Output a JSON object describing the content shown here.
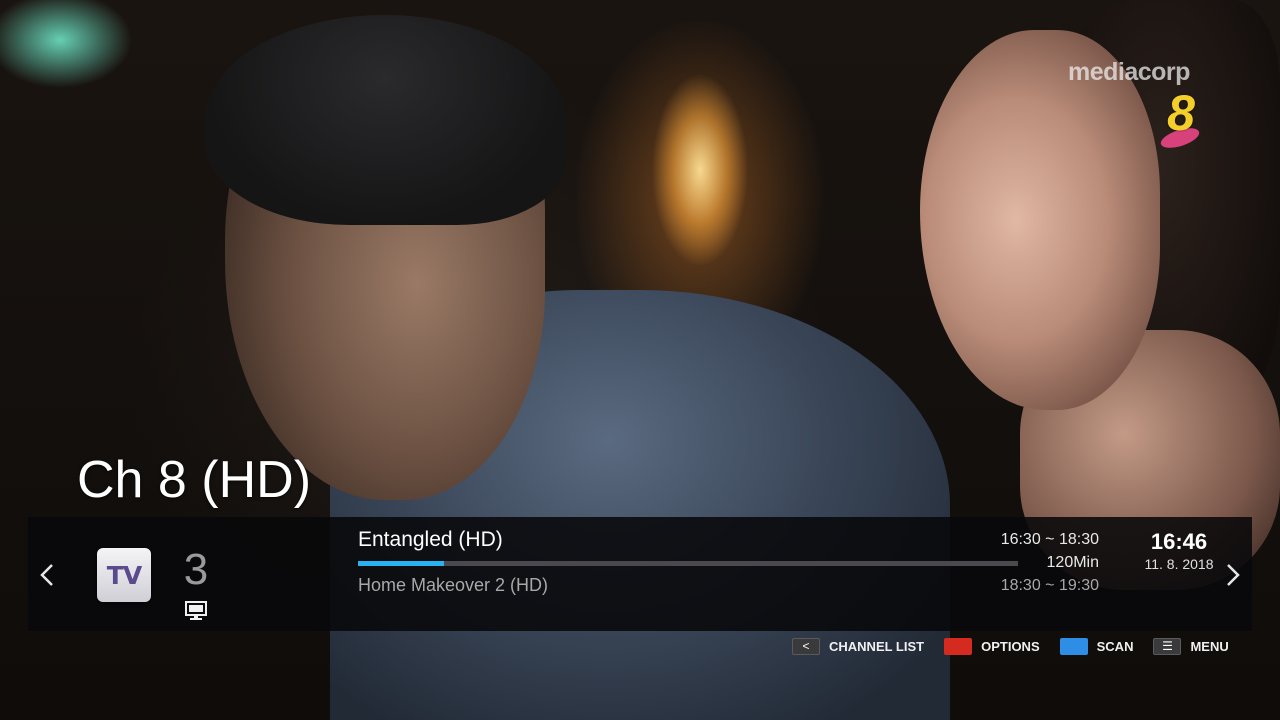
{
  "broadcaster": {
    "logo_text": "mediacorp",
    "logo_digit": "8",
    "colors": {
      "digit": "#f4cf2a",
      "swoosh": "#d7427a"
    }
  },
  "channel": {
    "title": "Ch 8 (HD)",
    "number": "3",
    "type_icon_label": "TV",
    "source_icon": "monitor-icon"
  },
  "program": {
    "current": {
      "title": "Entangled (HD)",
      "time": "16:30 ~ 18:30",
      "duration": "120Min",
      "progress": 0.13
    },
    "next": {
      "title": "Home Makeover 2 (HD)",
      "time": "18:30 ~ 19:30"
    }
  },
  "clock": {
    "time": "16:46",
    "date": "11. 8. 2018"
  },
  "navigation": {
    "prev_icon": "chevron-left-icon",
    "next_icon": "chevron-right-icon"
  },
  "hints": [
    {
      "key_icon": "back-key-icon",
      "key_glyph": "<",
      "label": "CHANNEL LIST"
    },
    {
      "key_icon": "red-key-icon",
      "key_color": "#d42a1f",
      "label": "OPTIONS"
    },
    {
      "key_icon": "blue-key-icon",
      "key_color": "#2e8ee6",
      "label": "SCAN"
    },
    {
      "key_icon": "menu-key-icon",
      "key_glyph": "☰",
      "label": "MENU"
    }
  ],
  "colors": {
    "accent_progress": "#2ab2f0",
    "bar_background": "#08080a"
  }
}
